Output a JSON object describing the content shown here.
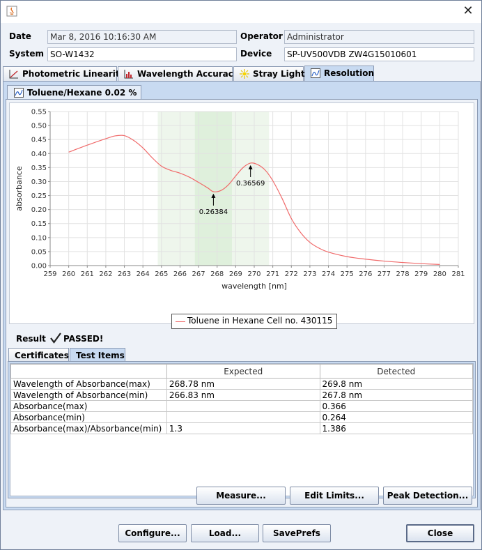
{
  "header": {
    "date_label": "Date",
    "date_value": "Mar 8, 2016 10:16:30 AM",
    "operator_label": "Operator",
    "operator_value": "Administrator",
    "system_label": "System",
    "system_value": "SO-W1432",
    "device_label": "Device",
    "device_value": "SP-UV500VDB ZW4G15010601"
  },
  "tabs": [
    {
      "label": "Photometric Linearity",
      "icon": "linearity-chart-icon"
    },
    {
      "label": "Wavelength Accuracy",
      "icon": "bar-chart-icon"
    },
    {
      "label": "Stray Light",
      "icon": "sun-icon"
    },
    {
      "label": "Resolution",
      "icon": "resolution-chart-icon",
      "active": true
    }
  ],
  "subtab": {
    "label": "Toluene/Hexane 0.02 %",
    "icon": "chart-icon"
  },
  "chart_data": {
    "type": "line",
    "xlabel": "wavelength [nm]",
    "ylabel": "absorbance",
    "xlim": [
      259,
      281
    ],
    "ylim": [
      0.0,
      0.55
    ],
    "xticks": [
      "259",
      "260",
      "261",
      "262",
      "263",
      "264",
      "265",
      "266",
      "267",
      "268",
      "269",
      "270",
      "271",
      "272",
      "273",
      "274",
      "275",
      "276",
      "277",
      "278",
      "279",
      "280",
      "281"
    ],
    "yticks": [
      "0.00",
      "0.05",
      "0.10",
      "0.15",
      "0.20",
      "0.25",
      "0.30",
      "0.35",
      "0.40",
      "0.45",
      "0.50",
      "0.55"
    ],
    "grid": true,
    "legend_position": "bottom-center",
    "series": [
      {
        "name": "Toluene in Hexane Cell no. 430115",
        "color": "#f06a6a",
        "x": [
          260,
          261,
          262,
          262.5,
          263,
          263.5,
          264,
          264.5,
          265,
          265.5,
          266,
          266.5,
          267,
          267.5,
          267.8,
          268.2,
          268.6,
          269,
          269.4,
          269.8,
          270.2,
          270.6,
          271,
          271.5,
          272,
          272.5,
          273,
          273.5,
          274,
          275,
          276,
          277,
          278,
          279,
          280
        ],
        "y": [
          0.405,
          0.43,
          0.453,
          0.463,
          0.464,
          0.447,
          0.42,
          0.385,
          0.355,
          0.34,
          0.33,
          0.316,
          0.297,
          0.277,
          0.264,
          0.268,
          0.288,
          0.32,
          0.35,
          0.366,
          0.36,
          0.34,
          0.303,
          0.24,
          0.168,
          0.118,
          0.083,
          0.062,
          0.048,
          0.032,
          0.023,
          0.016,
          0.011,
          0.007,
          0.004
        ]
      }
    ],
    "shaded_regions": [
      {
        "x_from": 264.8,
        "x_to": 270.8,
        "color": "#eef6ec"
      },
      {
        "x_from": 266.8,
        "x_to": 268.8,
        "color": "#dff0dc"
      }
    ],
    "annotations": [
      {
        "x": 267.8,
        "y": 0.264,
        "text": "0.26384"
      },
      {
        "x": 269.8,
        "y": 0.366,
        "text": "0.36569"
      }
    ]
  },
  "result": {
    "label": "Result",
    "value": "PASSED!"
  },
  "subtabs2": [
    {
      "label": "Certificates"
    },
    {
      "label": "Test Items",
      "active": true
    }
  ],
  "table": {
    "columns": [
      "",
      "Expected",
      "Detected"
    ],
    "rows": [
      [
        "Wavelength of Absorbance(max)",
        "268.78 nm",
        "269.8 nm"
      ],
      [
        "Wavelength of Absorbance(min)",
        "266.83 nm",
        "267.8 nm"
      ],
      [
        "Absorbance(max)",
        "",
        "0.366"
      ],
      [
        "Absorbance(min)",
        "",
        "0.264"
      ],
      [
        "Absorbance(max)/Absorbance(min)",
        "1.3",
        "1.386"
      ]
    ]
  },
  "inner_buttons": {
    "measure": "Measure...",
    "edit_limits": "Edit Limits...",
    "peak_detection": "Peak Detection..."
  },
  "footer_buttons": {
    "configure": "Configure...",
    "load": "Load...",
    "saveprefs": "SavePrefs",
    "close": "Close"
  }
}
